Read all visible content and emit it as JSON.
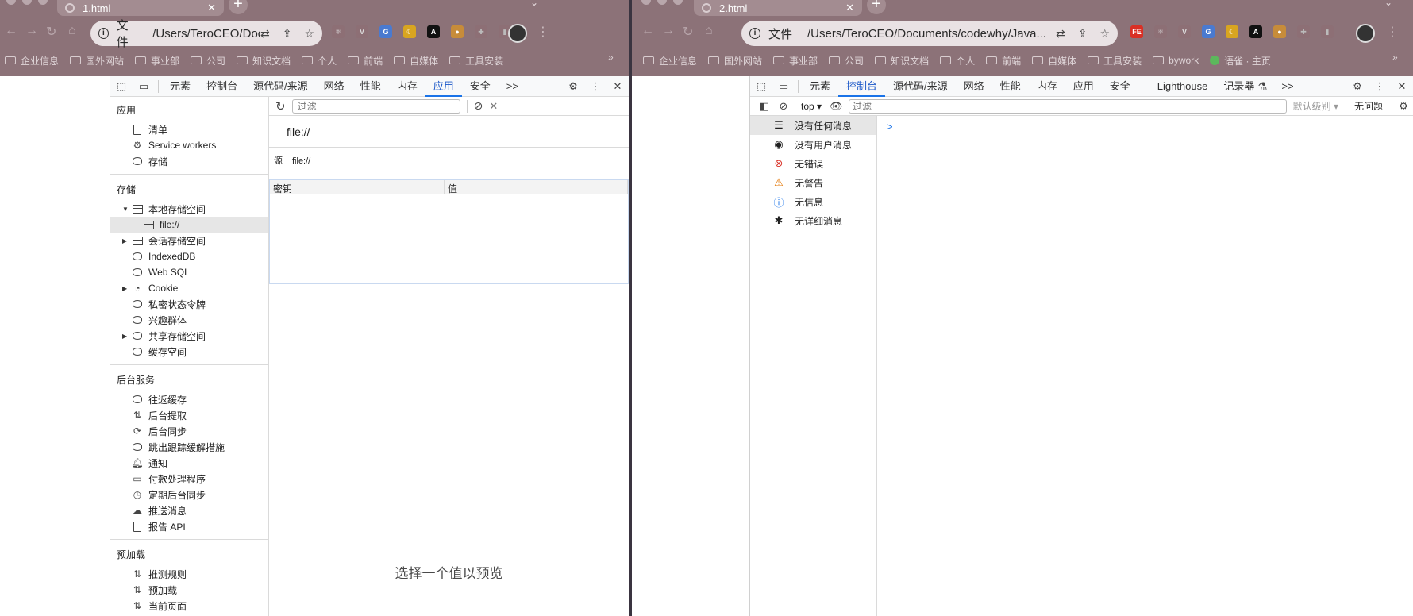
{
  "left": {
    "tab_title": "1.html",
    "address": {
      "scheme": "文件",
      "url": "/Users/TeroCEO/Doc..."
    },
    "bookmarks": [
      "企业信息",
      "国外网站",
      "事业部",
      "公司",
      "知识文档",
      "个人",
      "前端",
      "自媒体",
      "工具安装"
    ],
    "devtools": {
      "panels": [
        "元素",
        "控制台",
        "源代码/来源",
        "网络",
        "性能",
        "内存",
        "应用",
        "安全"
      ],
      "active_panel": "应用",
      "more": ">>",
      "sidebar": {
        "app_header": "应用",
        "app_items": [
          "清单",
          "Service workers",
          "存储"
        ],
        "storage_header": "存储",
        "local_storage": "本地存储空间",
        "local_storage_child": "file://",
        "session_storage": "会话存储空间",
        "indexeddb": "IndexedDB",
        "websql": "Web SQL",
        "cookie": "Cookie",
        "private_token": "私密状态令牌",
        "interest_groups": "兴趣群体",
        "shared_storage": "共享存储空间",
        "cache_storage": "缓存空间",
        "bg_header": "后台服务",
        "bg_items": [
          "往返缓存",
          "后台提取",
          "后台同步",
          "跳出跟踪缓解措施",
          "通知",
          "付款处理程序",
          "定期后台同步",
          "推送消息",
          "报告 API"
        ],
        "preload_header": "预加载",
        "preload_items": [
          "推测规则",
          "预加载",
          "当前页面"
        ]
      },
      "main": {
        "filter_placeholder": "过滤",
        "origin_title": "file://",
        "origin_label": "源",
        "origin_value": "file://",
        "col_key": "密钥",
        "col_value": "值",
        "preview_text": "选择一个值以预览"
      }
    }
  },
  "right": {
    "tab_title": "2.html",
    "address": {
      "scheme": "文件",
      "url": "/Users/TeroCEO/Documents/codewhy/Java..."
    },
    "bookmarks": [
      "企业信息",
      "国外网站",
      "事业部",
      "公司",
      "知识文档",
      "个人",
      "前端",
      "自媒体",
      "工具安装",
      "bywork",
      "语雀 · 主页"
    ],
    "devtools": {
      "panels": [
        "元素",
        "控制台",
        "源代码/来源",
        "网络",
        "性能",
        "内存",
        "应用",
        "安全",
        "Lighthouse",
        "记录器"
      ],
      "active_panel": "控制台",
      "more": ">>",
      "context": "top",
      "filter_placeholder": "过滤",
      "level": "默认级别",
      "issues": "无问题",
      "sidebar_items": [
        "没有任何消息",
        "没有用户消息",
        "无错误",
        "无警告",
        "无信息",
        "无详细消息"
      ],
      "prompt": ">"
    }
  },
  "colors": {
    "accent": "#1a73e8",
    "chrome": "#8c7278",
    "error": "#d93025",
    "warning": "#e37400",
    "info": "#1a73e8"
  }
}
